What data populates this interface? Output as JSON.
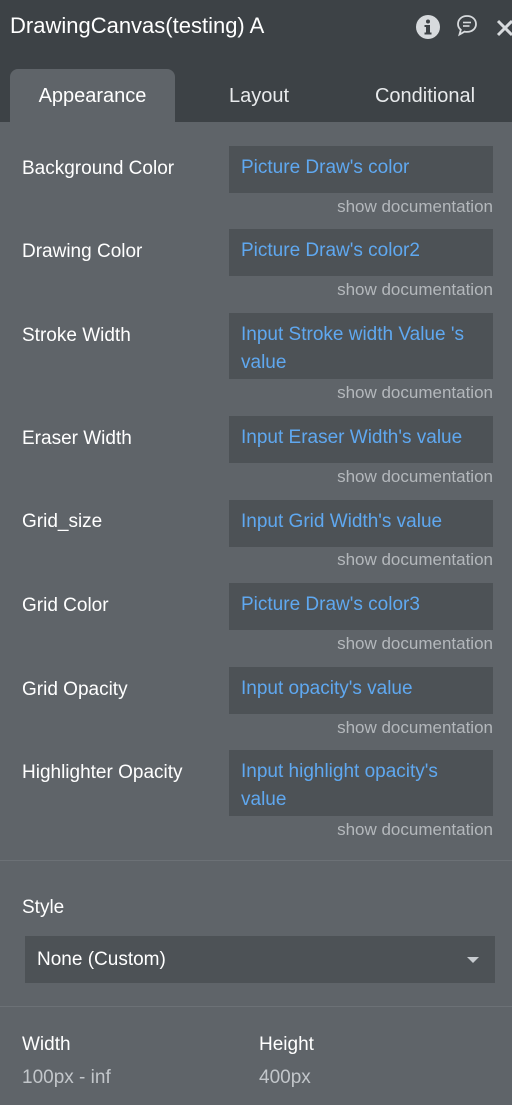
{
  "window": {
    "title": "DrawingCanvas(testing) A",
    "icons": [
      "info-icon",
      "comment-icon",
      "close-icon"
    ]
  },
  "tabs": [
    {
      "label": "Appearance",
      "active": true
    },
    {
      "label": "Layout",
      "active": false
    },
    {
      "label": "Conditional",
      "active": false
    }
  ],
  "properties": [
    {
      "label": "Background Color",
      "value": "Picture Draw's color",
      "doc": "show documentation"
    },
    {
      "label": "Drawing Color",
      "value": "Picture Draw's color2",
      "doc": "show documentation"
    },
    {
      "label": "Stroke Width",
      "value": "Input Stroke width Value 's value",
      "doc": "show documentation"
    },
    {
      "label": "Eraser Width",
      "value": "Input Eraser Width's value",
      "doc": "show documentation"
    },
    {
      "label": "Grid_size",
      "value": "Input Grid Width's value",
      "doc": "show documentation"
    },
    {
      "label": "Grid Color",
      "value": "Picture Draw's color3",
      "doc": "show documentation"
    },
    {
      "label": "Grid Opacity",
      "value": "Input opacity's value",
      "doc": "show documentation"
    },
    {
      "label": "Highlighter Opacity",
      "value": "Input highlight opacity's value",
      "doc": "show documentation"
    }
  ],
  "style": {
    "label": "Style",
    "selected": "None (Custom)"
  },
  "dimensions": {
    "width_label": "Width",
    "width_value": "100px - inf",
    "height_label": "Height",
    "height_value": "400px"
  },
  "colors": {
    "panel": "#5f6469",
    "header": "#3d4246",
    "field": "#4d5256",
    "link": "#5fa8f0"
  }
}
